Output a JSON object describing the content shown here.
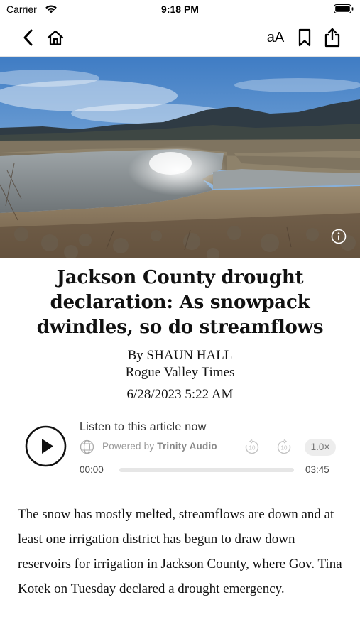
{
  "status_bar": {
    "carrier": "Carrier",
    "time": "9:18 PM"
  },
  "nav": {
    "back_icon": "chevron-left-icon",
    "home_icon": "home-icon",
    "font_size_label": "aA",
    "bookmark_icon": "bookmark-icon",
    "share_icon": "share-icon"
  },
  "hero": {
    "description_icon": "info-icon"
  },
  "article": {
    "headline": "Jackson County drought declaration: As snowpack dwindles, so do streamflows",
    "byline_author": "By SHAUN HALL",
    "byline_source": "Rogue Valley Times",
    "date": "6/28/2023 5:22 AM",
    "body": "The snow has mostly melted, streamflows are down and at least one irrigation district has begun to draw down reservoirs for irrigation in Jackson County, where Gov. Tina Kotek on Tuesday declared a drought emergency."
  },
  "audio_player": {
    "title": "Listen to this article now",
    "powered_prefix": "Powered by",
    "powered_brand": "Trinity Audio",
    "rewind_label": "10",
    "forward_label": "10",
    "speed": "1.0×",
    "current_time": "00:00",
    "total_time": "03:45",
    "progress": 0
  },
  "colors": {
    "text": "#111111",
    "muted": "#9a9a9a",
    "track": "#e6e6e6"
  }
}
